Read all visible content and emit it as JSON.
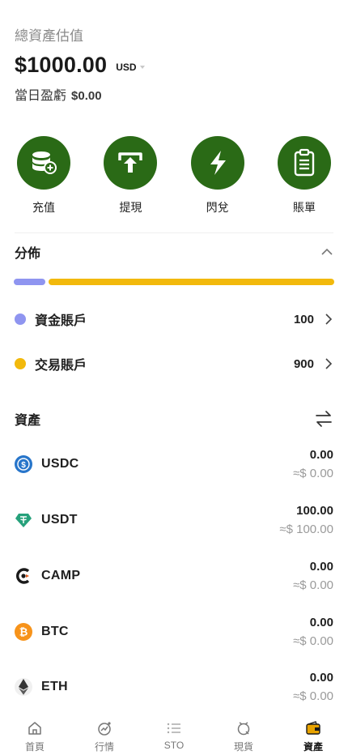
{
  "header": {
    "total_label": "總資產估值",
    "total_value": "$1000.00",
    "currency": "USD",
    "daily_label": "當日盈虧",
    "daily_value": "$0.00"
  },
  "actions": [
    {
      "label": "充值",
      "icon": "deposit-coins-icon"
    },
    {
      "label": "提現",
      "icon": "withdraw-upload-icon"
    },
    {
      "label": "閃兌",
      "icon": "lightning-icon"
    },
    {
      "label": "賬單",
      "icon": "clipboard-bill-icon"
    }
  ],
  "distribution": {
    "title": "分佈",
    "bar": [
      {
        "name": "資金賬戶",
        "fraction": 0.1,
        "color": "#8f95f0"
      },
      {
        "name": "交易賬戶",
        "fraction": 0.9,
        "color": "#f2b90c"
      }
    ],
    "accounts": [
      {
        "name": "資金賬戶",
        "value": "100",
        "color": "#8f95f0"
      },
      {
        "name": "交易賬戶",
        "value": "900",
        "color": "#f2b90c"
      }
    ]
  },
  "assets": {
    "title": "資產",
    "items": [
      {
        "symbol": "USDC",
        "amount": "0.00",
        "fiat": "≈$ 0.00",
        "icon": "usdc-icon",
        "color": "#2775ca"
      },
      {
        "symbol": "USDT",
        "amount": "100.00",
        "fiat": "≈$ 100.00",
        "icon": "usdt-icon",
        "color": "#26a17b"
      },
      {
        "symbol": "CAMP",
        "amount": "0.00",
        "fiat": "≈$ 0.00",
        "icon": "camp-icon",
        "color": "#1a1a1a"
      },
      {
        "symbol": "BTC",
        "amount": "0.00",
        "fiat": "≈$ 0.00",
        "icon": "btc-icon",
        "color": "#f7931a"
      },
      {
        "symbol": "ETH",
        "amount": "0.00",
        "fiat": "≈$ 0.00",
        "icon": "eth-icon",
        "color": "#343434"
      }
    ]
  },
  "tabbar": [
    {
      "label": "首頁",
      "icon": "home-icon",
      "active": false
    },
    {
      "label": "行情",
      "icon": "market-icon",
      "active": false
    },
    {
      "label": "STO",
      "icon": "list-icon",
      "active": false
    },
    {
      "label": "現貨",
      "icon": "spot-icon",
      "active": false
    },
    {
      "label": "資產",
      "icon": "wallet-icon",
      "active": true
    }
  ],
  "colors": {
    "accent_green": "#2a6a16",
    "accent_gold": "#f2b90c",
    "accent_purple": "#8f95f0"
  }
}
